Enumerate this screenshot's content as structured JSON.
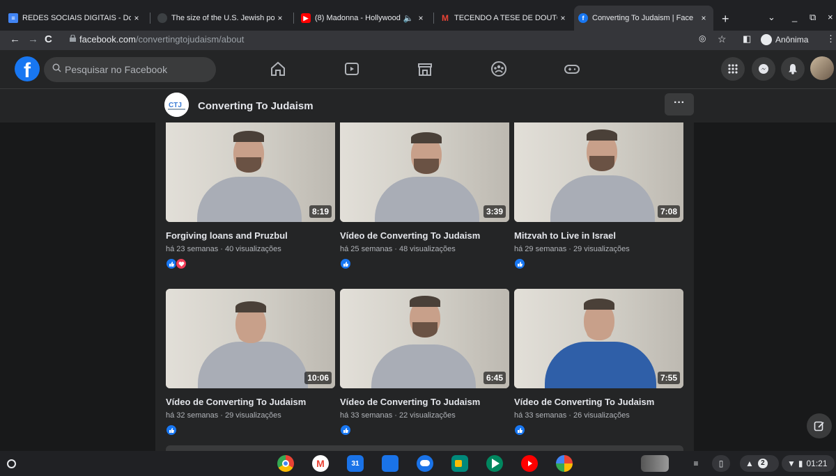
{
  "browser": {
    "tabs": [
      {
        "title": "REDES SOCIAIS DIGITAIS - Doc",
        "favicon": "docs-icon",
        "color": "#4285f4"
      },
      {
        "title": "The size of the U.S. Jewish po",
        "favicon": "site-icon",
        "color": "#3c4043"
      },
      {
        "title": "(8) Madonna - Hollywood",
        "favicon": "youtube-icon",
        "color": "#ff0000"
      },
      {
        "title": "TECENDO A TESE DE DOUTOR",
        "favicon": "gmail-icon",
        "color": "#ea4335"
      },
      {
        "title": "Converting To Judaism | Face",
        "favicon": "facebook-icon",
        "color": "#1877f2"
      }
    ],
    "close_glyph": "×",
    "new_tab_glyph": "+",
    "url_host": "facebook.com",
    "url_path": "/convertingtojudaism/about",
    "profile_label": "Anônima"
  },
  "facebook": {
    "logo_letter": "f",
    "search_placeholder": "Pesquisar no Facebook",
    "brand_color": "#1877f2"
  },
  "page": {
    "name": "Converting To Judaism",
    "more_label": "···"
  },
  "videos": [
    {
      "title": "Forgiving loans and Pruzbul",
      "meta": "há 23 semanas · 40 visualizações",
      "duration": "8:19",
      "reactions": [
        "like",
        "love"
      ]
    },
    {
      "title": "Vídeo de Converting To Judaism",
      "meta": "há 25 semanas · 48 visualizações",
      "duration": "3:39",
      "reactions": [
        "like"
      ]
    },
    {
      "title": "Mitzvah to Live in Israel",
      "meta": "há 29 semanas · 29 visualizações",
      "duration": "7:08",
      "reactions": [
        "like"
      ]
    },
    {
      "title": "Vídeo de Converting To Judaism",
      "meta": "há 32 semanas · 29 visualizações",
      "duration": "10:06",
      "reactions": [
        "like"
      ]
    },
    {
      "title": "Vídeo de Converting To Judaism",
      "meta": "há 33 semanas · 22 visualizações",
      "duration": "6:45",
      "reactions": [
        "like"
      ]
    },
    {
      "title": "Vídeo de Converting To Judaism",
      "meta": "há 33 semanas · 26 visualizações",
      "duration": "7:55",
      "reactions": [
        "like"
      ]
    }
  ],
  "shelf": {
    "apps": [
      {
        "name": "chrome-icon",
        "color": "#4285f4"
      },
      {
        "name": "gmail-icon",
        "color": "#ea4335"
      },
      {
        "name": "calendar-icon",
        "color": "#1a73e8"
      },
      {
        "name": "files-icon",
        "color": "#1a73e8"
      },
      {
        "name": "messages-icon",
        "color": "#1a73e8"
      },
      {
        "name": "meet-icon",
        "color": "#00897b"
      },
      {
        "name": "play-store-icon",
        "color": "#01875f"
      },
      {
        "name": "youtube-icon",
        "color": "#ff0000"
      },
      {
        "name": "photos-icon",
        "color": "#fbbc04"
      }
    ],
    "notification_count": "2",
    "clock": "01:21"
  }
}
